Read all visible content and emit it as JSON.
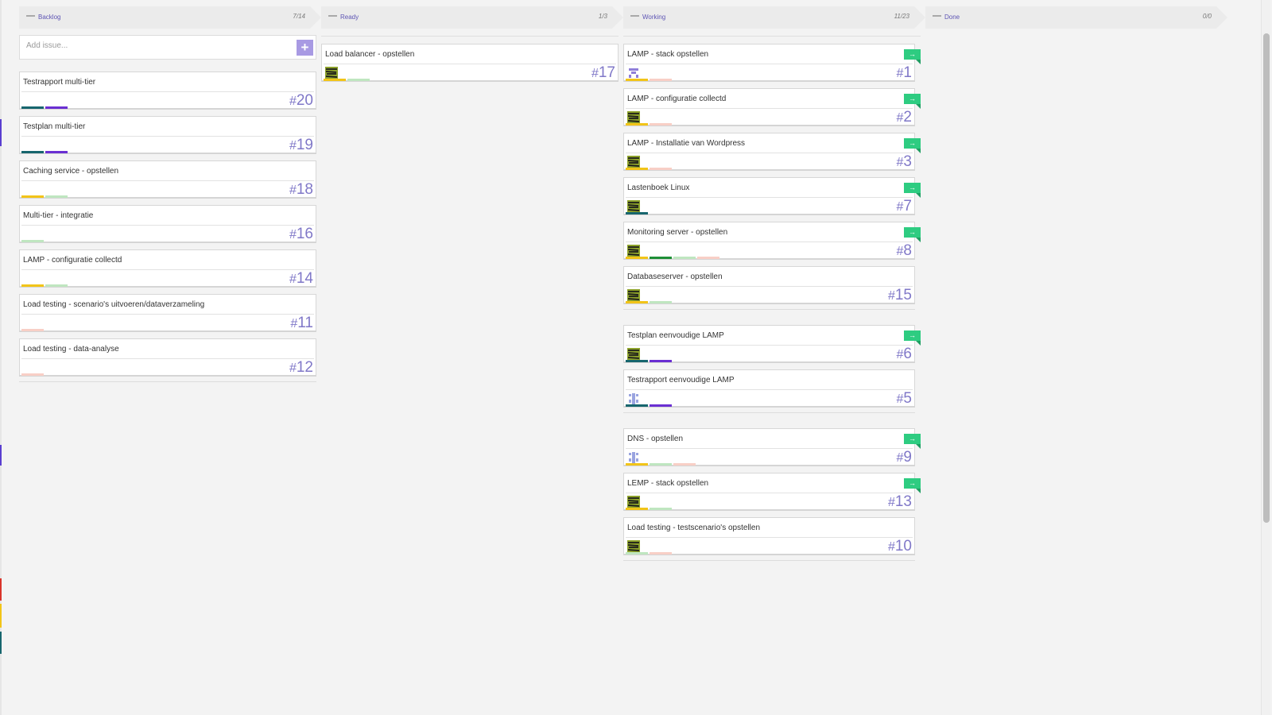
{
  "colors": {
    "title_purple": "#5e55b4",
    "number_purple": "#8078c8",
    "add_button": "#a89ae3",
    "move_flag": "#2ecc81",
    "label_teal": "#17666e",
    "label_violet": "#6a2fd2",
    "label_yellow": "#f2c418",
    "label_lightgreen": "#bfe6c0",
    "label_pink": "#f8cfc6",
    "label_green": "#1e8f37"
  },
  "columns": [
    {
      "title": "Backlog",
      "count": "7/14",
      "add_placeholder": "Add issue...",
      "add_button": "+",
      "cards": [
        {
          "title": "Testrapport multi-tier",
          "number": "20",
          "labels": [
            "label_teal",
            "label_violet"
          ]
        },
        {
          "title": "Testplan multi-tier",
          "number": "19",
          "labels": [
            "label_teal",
            "label_violet"
          ]
        },
        {
          "title": "Caching service - opstellen",
          "number": "18",
          "labels": [
            "label_yellow",
            "label_lightgreen"
          ]
        },
        {
          "title": "Multi-tier - integratie",
          "number": "16",
          "labels": [
            "label_lightgreen"
          ]
        },
        {
          "title": "LAMP - configuratie collectd",
          "number": "14",
          "labels": [
            "label_yellow",
            "label_lightgreen"
          ]
        },
        {
          "title": "Load testing - scenario's uitvoeren/dataverzameling",
          "number": "11",
          "labels": [
            "label_pink"
          ]
        },
        {
          "title": "Load testing - data-analyse",
          "number": "12",
          "labels": [
            "label_pink"
          ]
        }
      ]
    },
    {
      "title": "Ready",
      "count": "1/3",
      "cards": [
        {
          "title": "Load balancer - opstellen",
          "number": "17",
          "avatar": "striped-avatar-icon",
          "labels": [
            "label_yellow",
            "label_lightgreen"
          ]
        }
      ]
    },
    {
      "title": "Working",
      "count": "11/23",
      "groups": [
        [
          {
            "title": "LAMP - stack opstellen",
            "number": "1",
            "avatar": "purple-identicon-avatar-icon",
            "flag": "→",
            "labels": [
              "label_yellow",
              "label_pink"
            ]
          },
          {
            "title": "LAMP - configuratie collectd",
            "number": "2",
            "avatar": "striped-avatar-icon",
            "flag": "→",
            "labels": [
              "label_yellow",
              "label_pink"
            ]
          },
          {
            "title": "LAMP - Installatie van Wordpress",
            "number": "3",
            "avatar": "striped-avatar-icon",
            "flag": "→",
            "labels": [
              "label_yellow",
              "label_pink"
            ]
          },
          {
            "title": "Lastenboek Linux",
            "number": "7",
            "avatar": "striped-avatar-icon",
            "flag": "→",
            "labels": [
              "label_teal"
            ]
          },
          {
            "title": "Monitoring server - opstellen",
            "number": "8",
            "avatar": "striped-avatar-icon",
            "flag": "→",
            "labels": [
              "label_yellow",
              "label_green",
              "label_lightgreen",
              "label_pink"
            ]
          },
          {
            "title": "Databaseserver - opstellen",
            "number": "15",
            "avatar": "striped-avatar-icon",
            "labels": [
              "label_yellow",
              "label_lightgreen"
            ]
          }
        ],
        [
          {
            "title": "Testplan eenvoudige LAMP",
            "number": "6",
            "avatar": "striped-avatar-icon",
            "flag": "→",
            "labels": [
              "label_teal",
              "label_violet"
            ]
          },
          {
            "title": "Testrapport eenvoudige LAMP",
            "number": "5",
            "avatar": "blue-identicon-avatar-icon",
            "labels": [
              "label_teal",
              "label_violet"
            ]
          }
        ],
        [
          {
            "title": "DNS - opstellen",
            "number": "9",
            "avatar": "blue-identicon-avatar-icon",
            "flag": "→",
            "labels": [
              "label_yellow",
              "label_lightgreen",
              "label_pink"
            ]
          },
          {
            "title": "LEMP - stack opstellen",
            "number": "13",
            "avatar": "striped-avatar-icon",
            "flag": "→",
            "labels": [
              "label_yellow",
              "label_lightgreen"
            ]
          },
          {
            "title": "Load testing - testscenario's opstellen",
            "number": "10",
            "avatar": "striped-avatar-icon",
            "labels": [
              "label_lightgreen",
              "label_pink"
            ]
          }
        ]
      ]
    },
    {
      "title": "Done",
      "count": "0/0",
      "cards": []
    }
  ]
}
